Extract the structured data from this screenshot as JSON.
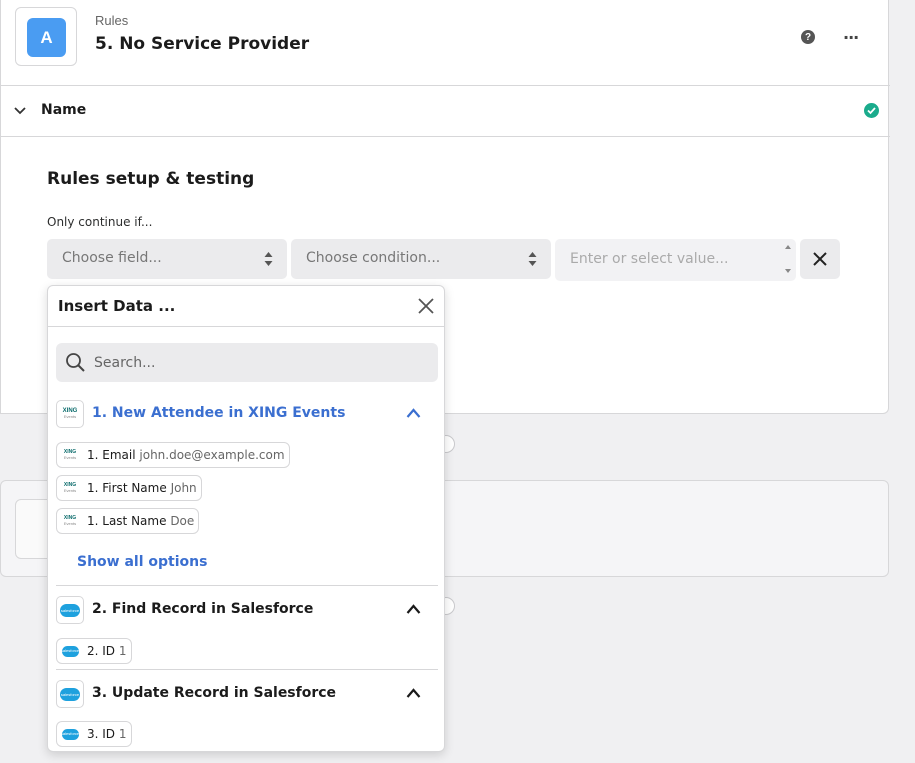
{
  "header": {
    "app_letter": "A",
    "app_label": "Rules",
    "step_title": "5. No Service Provider",
    "help_glyph": "?",
    "more_glyph": "···"
  },
  "name_section": {
    "label": "Name",
    "status": "complete"
  },
  "setup": {
    "title": "Rules setup & testing",
    "continue_label": "Only continue if...",
    "field_placeholder": "Choose field...",
    "condition_placeholder": "Choose condition...",
    "value_placeholder": "Enter or select value..."
  },
  "insert_data": {
    "title": "Insert Data ...",
    "search_placeholder": "Search...",
    "show_all_label": "Show all options",
    "groups": [
      {
        "title": "1. New Attendee in XING Events",
        "app_icon": "xing-events-logo",
        "logo_text": "XING",
        "logo_sub": "Events",
        "expanded": true,
        "active": true,
        "items": [
          {
            "label": "1. Email",
            "value": "john.doe@example.com"
          },
          {
            "label": "1. First Name",
            "value": "John"
          },
          {
            "label": "1. Last Name",
            "value": "Doe"
          }
        ]
      },
      {
        "title": "2. Find Record in Salesforce",
        "app_icon": "salesforce-logo",
        "logo_text": "salesforce",
        "expanded": true,
        "active": false,
        "items": [
          {
            "label": "2. ID",
            "value": "1"
          }
        ]
      },
      {
        "title": "3. Update Record in Salesforce",
        "app_icon": "salesforce-logo",
        "logo_text": "salesforce",
        "expanded": true,
        "active": false,
        "items": [
          {
            "label": "3. ID",
            "value": "1"
          }
        ]
      }
    ]
  },
  "colors": {
    "accent_blue": "#3b6fd0",
    "app_tile_blue": "#4a9cf2",
    "success_green": "#1aab8c",
    "salesforce_blue": "#1ea1de"
  }
}
